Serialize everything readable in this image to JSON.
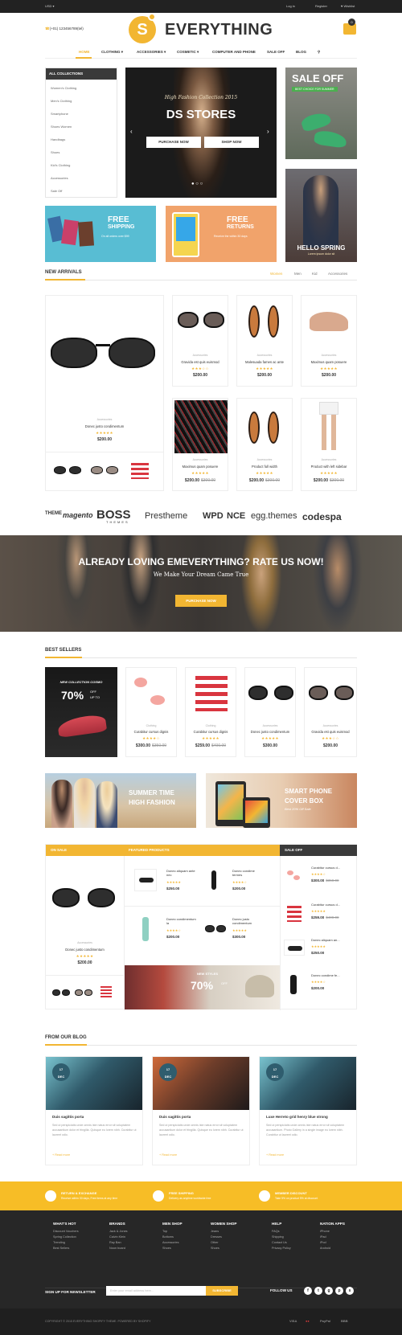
{
  "topbar": {
    "currency": "USD ▾",
    "login": "Log in",
    "register": "Register",
    "wishlist": "Wishlist"
  },
  "header": {
    "logo_letter": "S",
    "logo_text": "EVERYTHING",
    "phone": "(+01) 123456789(tel)",
    "cart_count": "0",
    "nav": [
      "HOME",
      "CLOTHING ▾",
      "ACCESSORIES ▾",
      "COSMETIC ▾",
      "COMPUTER AND PHONE",
      "SALE OFF",
      "BLOG"
    ]
  },
  "sidebar": {
    "title": "ALL COLLECTIONS",
    "items": [
      "Women's Clothing",
      "Men's Clothing",
      "Smartphone",
      "Shoes Women",
      "Handbags",
      "Shoes",
      "Kid's Clothing",
      "Accessories",
      "Sale Off"
    ]
  },
  "hero": {
    "subtitle": "High Fashion Collection 2015",
    "title": "DS STORES",
    "btn1": "PURCHASE NOW",
    "btn2": "SHOP NOW"
  },
  "promos": {
    "saleoff_title": "SALE OFF",
    "saleoff_badge": "BEST CHOICE FOR SUMMER",
    "spring_title": "HELLO SPRING",
    "spring_sub": "Lorem ipsum dolor sit",
    "ship_title": "FREE",
    "ship_title2": "SHIPPING",
    "ship_sub": "On all orders over $99",
    "ret_title": "FREE",
    "ret_title2": "RETURNS",
    "ret_sub": "Receive the within 30 days"
  },
  "new_arrivals": {
    "title": "NEW ARRIVALS",
    "tabs": [
      "Women",
      "Men",
      "Kid",
      "Accessories"
    ],
    "featured": {
      "cat": "Accessories",
      "name": "Donec justo condimentum",
      "price": "$200.00"
    },
    "products": [
      {
        "cat": "Accessories",
        "name": "Gravida est quis euismod",
        "price": "$200.00",
        "old": ""
      },
      {
        "cat": "Accessories",
        "name": "Malesuada fames ac ante",
        "price": "$200.00",
        "old": ""
      },
      {
        "cat": "Accessories",
        "name": "Maximus quam posuere",
        "price": "$200.00",
        "old": ""
      },
      {
        "cat": "Accessories",
        "name": "Maximus quam posuere",
        "price": "$200.00",
        "old": "$300.00"
      },
      {
        "cat": "Accessories",
        "name": "Product full width",
        "price": "$200.00",
        "old": "$300.00"
      },
      {
        "cat": "Accessories",
        "name": "Product with left sidebar",
        "price": "$200.00",
        "old": "$300.00"
      }
    ]
  },
  "brands": [
    "THEME",
    "magento",
    "BOSS",
    "Prestheme",
    "WPD",
    "NCE",
    "egg.themes",
    "codespa"
  ],
  "brands_sub": "THEMES",
  "rate": {
    "title": "ALREADY LOVING EMEVERYTHING? RATE US NOW!",
    "subtitle": "We Make Your Dream Came True",
    "button": "PURCHASE NOW"
  },
  "best_sellers": {
    "title": "BEST SELLERS",
    "collection_label": "NEW COLLECTION COSMO",
    "collection_pct": "70%",
    "collection_off": "OFF",
    "collection_upto": "UP TO",
    "products": [
      {
        "cat": "Clothing",
        "name": "Curabitur cursus dignis",
        "price": "$300.00",
        "old": "$350.00"
      },
      {
        "cat": "Clothing",
        "name": "Curabitur cursus dignis",
        "price": "$259.00",
        "old": "$400.00"
      },
      {
        "cat": "Accessories",
        "name": "Donec justo condimentum",
        "price": "$300.00",
        "old": ""
      },
      {
        "cat": "Accessories",
        "name": "Gravida est quis euismod",
        "price": "$200.00",
        "old": ""
      }
    ]
  },
  "banners2": {
    "summer_title": "SUMMER TIME",
    "summer_title2": "HIGH FASHION",
    "phone_title": "SMART PHONE",
    "phone_title2": "COVER BOX",
    "phone_sub": "Best 20% Off Sale"
  },
  "deals": {
    "onsale_title": "ON SALE",
    "featured_title": "FEATURED PRODUCTS",
    "saleoff_title": "SALE OFF",
    "onsale_product": {
      "cat": "Accessories",
      "name": "Donec justo condimentum",
      "price": "$200.00"
    },
    "featured": [
      {
        "name": "Donec aliquam ante nec",
        "price": "$250.00"
      },
      {
        "name": "Donec condime termes",
        "price": "$200.00"
      },
      {
        "name": "Donec condimentum la",
        "price": "$200.00"
      },
      {
        "name": "Donec justo condimentum",
        "price": "$300.00"
      }
    ],
    "saleoff": [
      {
        "name": "Curabitur cursus d...",
        "price": "$300.00",
        "old": "$350.00"
      },
      {
        "name": "Curabitur cursus d...",
        "price": "$259.00",
        "old": "$400.00"
      },
      {
        "name": "Donec aliquam an...",
        "price": "$250.00",
        "old": ""
      },
      {
        "name": "Donec condime fe...",
        "price": "$200.00",
        "old": ""
      }
    ],
    "style_label": "NEW STYLES",
    "style_pct": "70%",
    "style_off": "OFF"
  },
  "blog": {
    "title": "FROM OUR BLOG",
    "posts": [
      {
        "day": "17",
        "mon": "DEC",
        "title": "Duis sagittis porta",
        "text": "Sed ut perspiciatis unde omnis iste natus error sit voluptatem accusantium dolor et fringilla. Quisque eu lorem nibh. Curabitur ut laoreet odio.",
        "more": "+ Read more"
      },
      {
        "day": "17",
        "mon": "DEC",
        "title": "Duis sagittis porta",
        "text": "Sed ut perspiciatis unde omnis iste natus error sit voluptatem accusantium dolor et fringilla. Quisque eu lorem nibh. Curabitur ut laoreet odio.",
        "more": "+ Read more"
      },
      {
        "day": "17",
        "mon": "DEC",
        "title": "Luxe Herreto grid henry blue strong",
        "text": "Sed ut perspiciatis unde omnis iste natus error sit voluptatem accusantium. Photo Gallery in a single image eu lorem nibh. Curabitur ut laoreet odio.",
        "more": "+ Read more"
      }
    ]
  },
  "features": [
    {
      "title": "RETURN & EXCHANGE",
      "sub": "Receive within 30 days, Free items at any time"
    },
    {
      "title": "FREE SHIPPING",
      "sub": "Delivery as anytime worldwide free"
    },
    {
      "title": "MEMBER DISCOUNT",
      "sub": "Take 5% on product 5% at discount"
    }
  ],
  "footer": {
    "columns": [
      {
        "title": "WHAT'S HOT",
        "items": [
          "Discount Vouchers",
          "Spring Collection",
          "Trending",
          "Best Sellers"
        ]
      },
      {
        "title": "BRANDS",
        "items": [
          "Jack & Jones",
          "Calvin Klein",
          "Ray Ban",
          "Noon board"
        ]
      },
      {
        "title": "MEN SHOP",
        "items": [
          "Top",
          "Bottoms",
          "Accessories",
          "Shoes"
        ]
      },
      {
        "title": "WOMEN SHOP",
        "items": [
          "Jeans",
          "Dresses",
          "Other",
          "Shoes"
        ]
      },
      {
        "title": "HELP",
        "items": [
          "FAQs",
          "Shipping",
          "Contact Us",
          "Privacy Policy"
        ]
      },
      {
        "title": "NATION APPS",
        "items": [
          "iPhone",
          "iPad",
          "iPod",
          "Android"
        ]
      }
    ],
    "newsletter_label": "SIGN UP FOR NEWSLETTER",
    "newsletter_placeholder": "Enter your email address here...",
    "subscribe": "SUBSCRIBE",
    "follow": "FOLLOW US",
    "social": [
      "f",
      "t",
      "g",
      "p",
      "s"
    ],
    "copyright": "COPYRIGHT © 2015 EVERYTHING SHOPIFY THEME. POWERED BY SHOPIFY",
    "payments": [
      "VISA",
      "●●",
      "PayPal",
      "BBB"
    ]
  }
}
